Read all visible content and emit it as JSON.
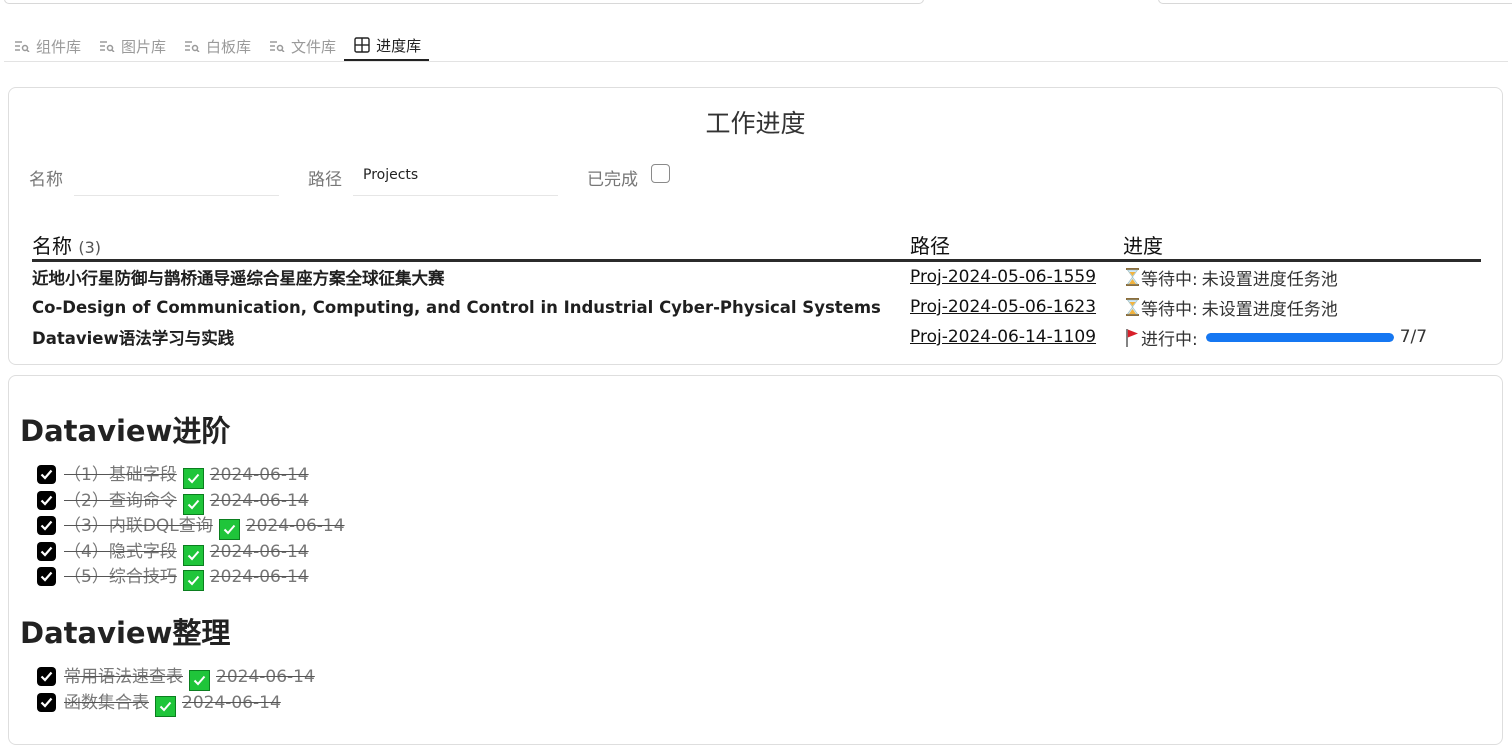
{
  "tabs": [
    {
      "label": "组件库",
      "icon": "list-search-icon"
    },
    {
      "label": "图片库",
      "icon": "list-search-icon"
    },
    {
      "label": "白板库",
      "icon": "list-search-icon"
    },
    {
      "label": "文件库",
      "icon": "list-search-icon"
    },
    {
      "label": "进度库",
      "icon": "table-grid-icon",
      "active": true
    }
  ],
  "progress_view": {
    "title": "工作进度",
    "filters": {
      "name_label": "名称",
      "name_value": "",
      "path_label": "路径",
      "path_value": "Projects",
      "completed_label": "已完成",
      "completed_checked": false
    },
    "table": {
      "headers": {
        "name": "名称",
        "count": "(3)",
        "path": "路径",
        "progress": "进度"
      },
      "rows": [
        {
          "name": "近地小行星防御与鹊桥通导遥综合星座方案全球征集大赛",
          "path": "Proj-2024-05-06-1559",
          "status_icon": "hourglass-icon",
          "status": "等待中:",
          "detail": "未设置进度任务池"
        },
        {
          "name": "Co-Design of Communication, Computing, and Control in Industrial Cyber-Physical Systems",
          "path": "Proj-2024-05-06-1623",
          "status_icon": "hourglass-icon",
          "status": "等待中:",
          "detail": "未设置进度任务池"
        },
        {
          "name": "Dataview语法学习与实践",
          "path": "Proj-2024-06-14-1109",
          "status_icon": "red-flag-icon",
          "status": "进行中:",
          "progress_fraction": 1.0,
          "progress_text": "7/7"
        }
      ]
    }
  },
  "tasks_view": {
    "sections": [
      {
        "heading": "Dataview进阶",
        "tasks": [
          {
            "text": "（1）基础字段",
            "date": "2024-06-14"
          },
          {
            "text": "（2）查询命令",
            "date": "2024-06-14"
          },
          {
            "text": "（3）内联DQL查询",
            "date": "2024-06-14"
          },
          {
            "text": "（4）隐式字段",
            "date": "2024-06-14"
          },
          {
            "text": "（5）综合技巧",
            "date": "2024-06-14"
          }
        ]
      },
      {
        "heading": "Dataview整理",
        "tasks": [
          {
            "text": "常用语法速查表",
            "date": "2024-06-14"
          },
          {
            "text": "函数集合表",
            "date": "2024-06-14"
          }
        ]
      }
    ]
  },
  "colors": {
    "progress_bar": "#1577f2",
    "done_check": "#1fc53a",
    "flag": "#d81f2a"
  }
}
